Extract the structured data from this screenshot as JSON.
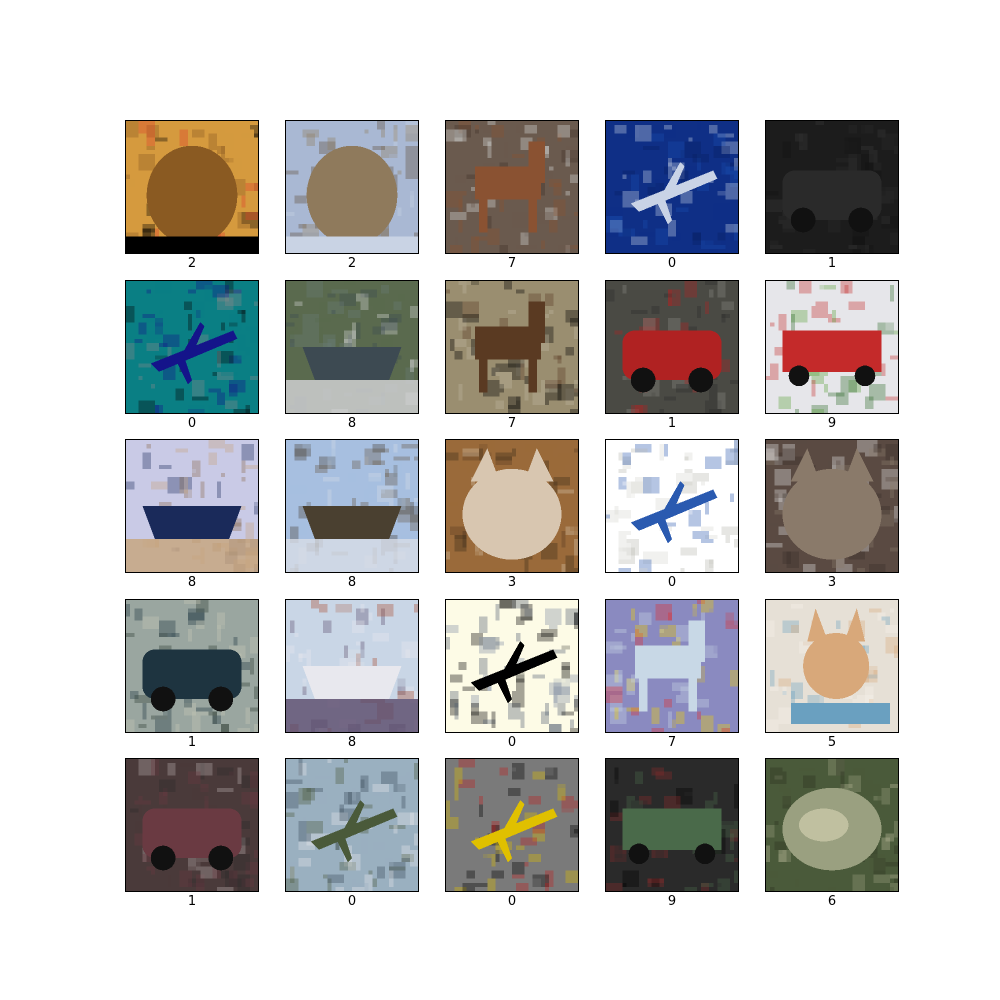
{
  "images": [
    {
      "label": "2",
      "subject": "rooster-head",
      "colors": [
        "#d59a3e",
        "#8a5a22",
        "#e0402a",
        "#000000"
      ]
    },
    {
      "label": "2",
      "subject": "ostrich-head",
      "colors": [
        "#a9b8d3",
        "#8f7a5c",
        "#5e4a36",
        "#c9d3e4"
      ]
    },
    {
      "label": "7",
      "subject": "horse",
      "colors": [
        "#6a5a4e",
        "#8a5232",
        "#3e3028",
        "#d9dfe0"
      ]
    },
    {
      "label": "0",
      "subject": "airplane-sky",
      "colors": [
        "#0f2f86",
        "#1b4cb0",
        "#c9d3e6",
        "#0a2060"
      ]
    },
    {
      "label": "1",
      "subject": "dark-car",
      "colors": [
        "#1c1c1c",
        "#2a2a2a",
        "#3a3a3a",
        "#121212"
      ]
    },
    {
      "label": "0",
      "subject": "blue-black-abstract",
      "colors": [
        "#0a7f84",
        "#050505",
        "#14148a",
        "#8a8a8a"
      ]
    },
    {
      "label": "8",
      "subject": "ship-river",
      "colors": [
        "#5a6a4e",
        "#3d4a52",
        "#d6d6da",
        "#6a7a78"
      ]
    },
    {
      "label": "7",
      "subject": "horse-rotated",
      "colors": [
        "#9a8e70",
        "#5a3a22",
        "#bfb6a0",
        "#000000"
      ]
    },
    {
      "label": "1",
      "subject": "red-van",
      "colors": [
        "#4a4a44",
        "#b02222",
        "#8a8a84",
        "#2a2a2a"
      ]
    },
    {
      "label": "9",
      "subject": "fire-truck",
      "colors": [
        "#e6e6ea",
        "#2e6a2a",
        "#c42a2a",
        "#5aa03a"
      ]
    },
    {
      "label": "8",
      "subject": "ship-upside-down",
      "colors": [
        "#c9cae6",
        "#1a2a5a",
        "#c7a47a",
        "#8a6a4a"
      ]
    },
    {
      "label": "8",
      "subject": "ship",
      "colors": [
        "#a7bfe0",
        "#4a4030",
        "#d8dde6",
        "#6a5a44"
      ]
    },
    {
      "label": "3",
      "subject": "cat-closeup",
      "colors": [
        "#9a6a3a",
        "#d8c6b0",
        "#5a3a22",
        "#3a2a1a"
      ]
    },
    {
      "label": "0",
      "subject": "airplane-white",
      "colors": [
        "#ffffff",
        "#b8b8b0",
        "#2a5ab0",
        "#d8d8d0"
      ]
    },
    {
      "label": "3",
      "subject": "cat",
      "colors": [
        "#5a4a42",
        "#8a7a6a",
        "#e6e6e6",
        "#3a2e28"
      ]
    },
    {
      "label": "1",
      "subject": "dark-sedan",
      "colors": [
        "#9aa6a0",
        "#1e3440",
        "#2a3a30",
        "#c8c8b8"
      ]
    },
    {
      "label": "8",
      "subject": "speedboat",
      "colors": [
        "#c9d6e6",
        "#e8e8ee",
        "#5a4a6a",
        "#a84a2a"
      ]
    },
    {
      "label": "0",
      "subject": "plane-silhouette",
      "colors": [
        "#fdfbe6",
        "#4a5a6e",
        "#000000",
        "#7a8aa0"
      ]
    },
    {
      "label": "7",
      "subject": "inverted-horse",
      "colors": [
        "#8a8ac0",
        "#c8d8e6",
        "#e02a2a",
        "#f0d000"
      ]
    },
    {
      "label": "5",
      "subject": "dog",
      "colors": [
        "#e6e0d6",
        "#d8a87a",
        "#6aa0c0",
        "#f6f2ea"
      ]
    },
    {
      "label": "1",
      "subject": "car-tilted",
      "colors": [
        "#4a3a3a",
        "#6a3a42",
        "#b8aeb0",
        "#2a2a2a"
      ]
    },
    {
      "label": "0",
      "subject": "airplane-runway",
      "colors": [
        "#9ab0c0",
        "#e8e8ea",
        "#4a5a3a",
        "#3a4a5a"
      ]
    },
    {
      "label": "0",
      "subject": "plane-silhouette-gray",
      "colors": [
        "#7a7a7a",
        "#000000",
        "#e0c000",
        "#c02020"
      ]
    },
    {
      "label": "9",
      "subject": "truck",
      "colors": [
        "#2a2a2a",
        "#8a2a2a",
        "#4a6a4a",
        "#000000"
      ]
    },
    {
      "label": "6",
      "subject": "frog",
      "colors": [
        "#4a5a3a",
        "#9aa080",
        "#2a3020",
        "#c0c0a0"
      ]
    }
  ]
}
